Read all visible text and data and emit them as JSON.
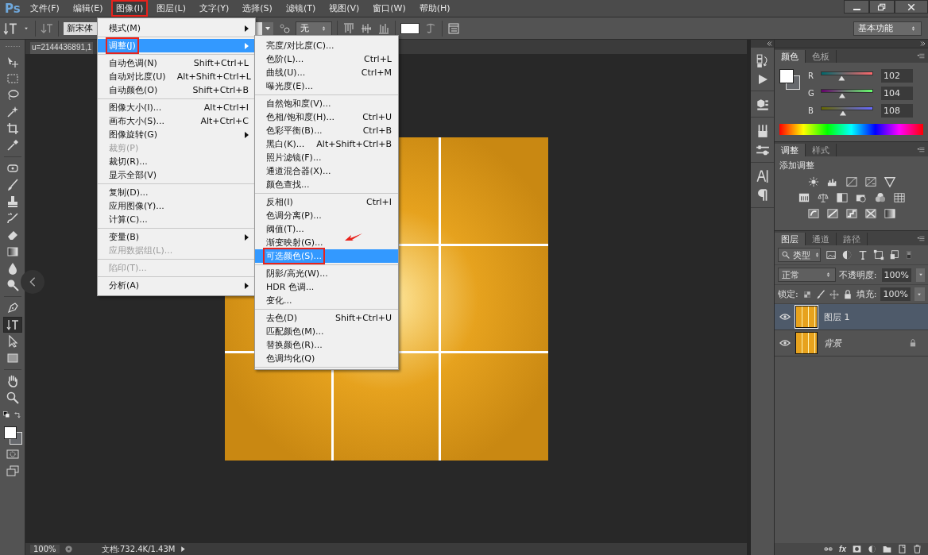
{
  "app": {
    "logo": "Ps"
  },
  "menu_bar": [
    {
      "label": "文件(F)",
      "selected": false,
      "marked": false
    },
    {
      "label": "编辑(E)",
      "selected": false,
      "marked": false
    },
    {
      "label": "图像(I)",
      "selected": true,
      "marked": true
    },
    {
      "label": "图层(L)",
      "selected": false,
      "marked": false
    },
    {
      "label": "文字(Y)",
      "selected": false,
      "marked": false
    },
    {
      "label": "选择(S)",
      "selected": false,
      "marked": false
    },
    {
      "label": "滤镜(T)",
      "selected": false,
      "marked": false
    },
    {
      "label": "视图(V)",
      "selected": false,
      "marked": false
    },
    {
      "label": "窗口(W)",
      "selected": false,
      "marked": false
    },
    {
      "label": "帮助(H)",
      "selected": false,
      "marked": false
    }
  ],
  "options_bar": {
    "font_family": "新宋体",
    "antialias": "无",
    "workspace": "基本功能"
  },
  "toolbar": {
    "groups": [
      [
        {
          "kind": "move",
          "selected": false
        },
        {
          "kind": "marquee",
          "selected": false
        },
        {
          "kind": "lasso",
          "selected": false
        },
        {
          "kind": "wand",
          "selected": false
        },
        {
          "kind": "crop",
          "selected": false
        },
        {
          "kind": "eyedropper",
          "selected": false
        }
      ],
      [
        {
          "kind": "healing",
          "selected": false
        },
        {
          "kind": "brush",
          "selected": false
        },
        {
          "kind": "stamp",
          "selected": false
        },
        {
          "kind": "history",
          "selected": false
        },
        {
          "kind": "eraser",
          "selected": false
        },
        {
          "kind": "gradient",
          "selected": false
        },
        {
          "kind": "blur",
          "selected": false
        },
        {
          "kind": "dodge",
          "selected": false
        }
      ],
      [
        {
          "kind": "pen",
          "selected": false
        },
        {
          "kind": "type",
          "selected": true
        },
        {
          "kind": "path",
          "selected": false
        },
        {
          "kind": "shape",
          "selected": false
        }
      ],
      [
        {
          "kind": "hand",
          "selected": false
        },
        {
          "kind": "zoom",
          "selected": false
        }
      ]
    ]
  },
  "document": {
    "tab_title": "u=2144436891,1",
    "zoom": "100%",
    "doc_info": "文档:732.4K/1.43M"
  },
  "image_menu": {
    "sections": [
      [
        {
          "label": "模式(M)",
          "submenu": true,
          "disabled": false,
          "selected": false,
          "marked": false
        }
      ],
      [
        {
          "label": "调整(J)",
          "submenu": true,
          "disabled": false,
          "selected": true,
          "marked": true
        }
      ],
      [
        {
          "label": "自动色调(N)",
          "shortcut": "Shift+Ctrl+L",
          "submenu": false,
          "disabled": false,
          "selected": false,
          "marked": false
        },
        {
          "label": "自动对比度(U)",
          "shortcut": "Alt+Shift+Ctrl+L",
          "submenu": false,
          "disabled": false,
          "selected": false,
          "marked": false
        },
        {
          "label": "自动颜色(O)",
          "shortcut": "Shift+Ctrl+B",
          "submenu": false,
          "disabled": false,
          "selected": false,
          "marked": false
        }
      ],
      [
        {
          "label": "图像大小(I)...",
          "shortcut": "Alt+Ctrl+I",
          "submenu": false,
          "disabled": false,
          "selected": false,
          "marked": false
        },
        {
          "label": "画布大小(S)...",
          "shortcut": "Alt+Ctrl+C",
          "submenu": false,
          "disabled": false,
          "selected": false,
          "marked": false
        },
        {
          "label": "图像旋转(G)",
          "submenu": true,
          "disabled": false,
          "selected": false,
          "marked": false
        },
        {
          "label": "裁剪(P)",
          "submenu": false,
          "disabled": true,
          "selected": false,
          "marked": false
        },
        {
          "label": "裁切(R)...",
          "submenu": false,
          "disabled": false,
          "selected": false,
          "marked": false
        },
        {
          "label": "显示全部(V)",
          "submenu": false,
          "disabled": false,
          "selected": false,
          "marked": false
        }
      ],
      [
        {
          "label": "复制(D)...",
          "submenu": false,
          "disabled": false,
          "selected": false,
          "marked": false
        },
        {
          "label": "应用图像(Y)...",
          "submenu": false,
          "disabled": false,
          "selected": false,
          "marked": false
        },
        {
          "label": "计算(C)...",
          "submenu": false,
          "disabled": false,
          "selected": false,
          "marked": false
        }
      ],
      [
        {
          "label": "变量(B)",
          "submenu": true,
          "disabled": false,
          "selected": false,
          "marked": false
        },
        {
          "label": "应用数据组(L)...",
          "submenu": false,
          "disabled": true,
          "selected": false,
          "marked": false
        }
      ],
      [
        {
          "label": "陷印(T)...",
          "submenu": false,
          "disabled": true,
          "selected": false,
          "marked": false
        }
      ],
      [
        {
          "label": "分析(A)",
          "submenu": true,
          "disabled": false,
          "selected": false,
          "marked": false
        }
      ]
    ]
  },
  "adjust_submenu": {
    "sections": [
      [
        {
          "label": "亮度/对比度(C)...",
          "selected": false,
          "marked": false
        },
        {
          "label": "色阶(L)...",
          "shortcut": "Ctrl+L",
          "selected": false,
          "marked": false
        },
        {
          "label": "曲线(U)...",
          "shortcut": "Ctrl+M",
          "selected": false,
          "marked": false
        },
        {
          "label": "曝光度(E)...",
          "selected": false,
          "marked": false
        }
      ],
      [
        {
          "label": "自然饱和度(V)...",
          "selected": false,
          "marked": false
        },
        {
          "label": "色相/饱和度(H)...",
          "shortcut": "Ctrl+U",
          "selected": false,
          "marked": false
        },
        {
          "label": "色彩平衡(B)...",
          "shortcut": "Ctrl+B",
          "selected": false,
          "marked": false
        },
        {
          "label": "黑白(K)...",
          "shortcut": "Alt+Shift+Ctrl+B",
          "selected": false,
          "marked": false
        },
        {
          "label": "照片滤镜(F)...",
          "selected": false,
          "marked": false
        },
        {
          "label": "通道混合器(X)...",
          "selected": false,
          "marked": false
        },
        {
          "label": "颜色查找...",
          "selected": false,
          "marked": false
        }
      ],
      [
        {
          "label": "反相(I)",
          "shortcut": "Ctrl+I",
          "selected": false,
          "marked": false
        },
        {
          "label": "色调分离(P)...",
          "selected": false,
          "marked": false
        },
        {
          "label": "阈值(T)...",
          "selected": false,
          "marked": false
        },
        {
          "label": "渐变映射(G)...",
          "selected": false,
          "marked": false
        },
        {
          "label": "可选颜色(S)...",
          "selected": true,
          "marked": true
        }
      ],
      [
        {
          "label": "阴影/高光(W)...",
          "selected": false,
          "marked": false
        },
        {
          "label": "HDR 色调...",
          "selected": false,
          "marked": false
        },
        {
          "label": "变化...",
          "selected": false,
          "marked": false
        }
      ],
      [
        {
          "label": "去色(D)",
          "shortcut": "Shift+Ctrl+U",
          "selected": false,
          "marked": false
        },
        {
          "label": "匹配颜色(M)...",
          "selected": false,
          "marked": false
        },
        {
          "label": "替换颜色(R)...",
          "selected": false,
          "marked": false
        },
        {
          "label": "色调均化(Q)",
          "selected": false,
          "marked": false
        }
      ]
    ]
  },
  "color_panel": {
    "tabs": [
      {
        "label": "颜色",
        "selected": true
      },
      {
        "label": "色板",
        "selected": false
      }
    ],
    "channels": [
      {
        "name": "R",
        "value": "102",
        "level": 0.4
      },
      {
        "name": "G",
        "value": "104",
        "level": 0.408
      },
      {
        "name": "B",
        "value": "108",
        "level": 0.424
      }
    ]
  },
  "adjustments_panel": {
    "tabs": [
      {
        "label": "调整",
        "selected": true
      },
      {
        "label": "样式",
        "selected": false
      }
    ],
    "heading": "添加调整"
  },
  "layers_panel": {
    "tabs": [
      {
        "label": "图层",
        "selected": true
      },
      {
        "label": "通道",
        "selected": false
      },
      {
        "label": "路径",
        "selected": false
      }
    ],
    "filter": "类型",
    "blend_mode": "正常",
    "opacity_label": "不透明度:",
    "opacity": "100%",
    "lock_label": "锁定:",
    "fill_label": "填充:",
    "fill": "100%",
    "layers": [
      {
        "name": "图层 1",
        "selected": true,
        "visible": true,
        "locked": false
      },
      {
        "name": "背景",
        "selected": false,
        "visible": true,
        "locked": true
      }
    ],
    "footer_fx": "fx"
  }
}
